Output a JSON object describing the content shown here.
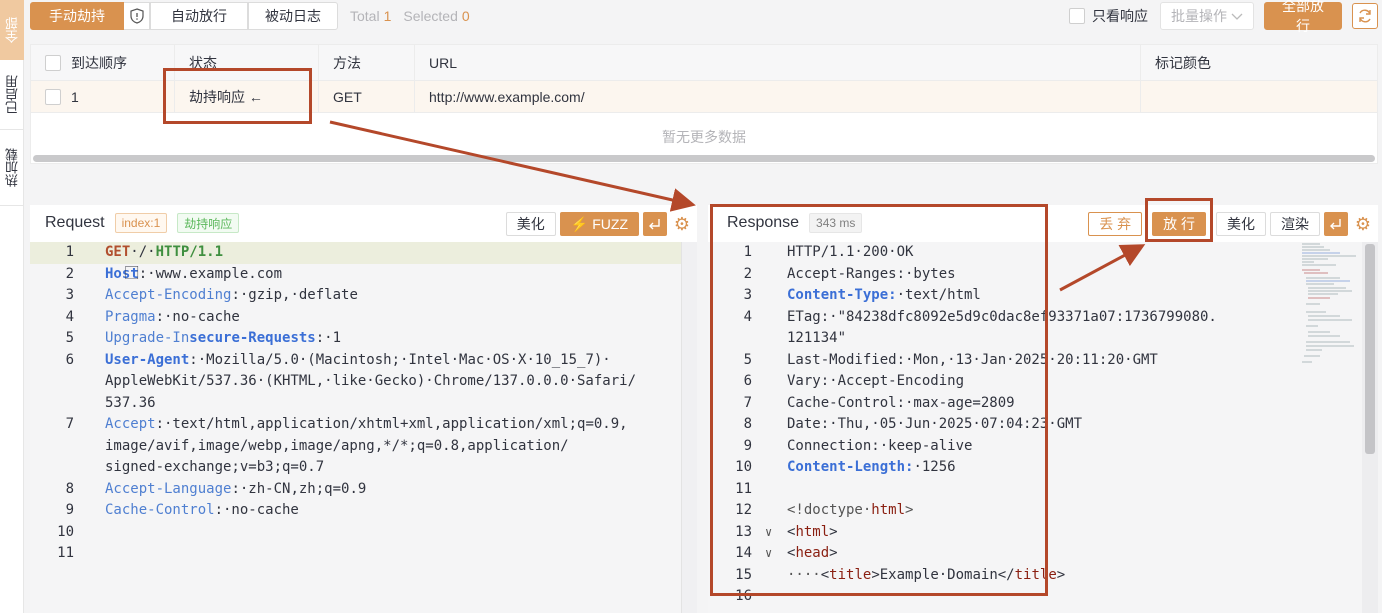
{
  "side_tabs": [
    "全部",
    "已启用",
    "热加载"
  ],
  "toolbar": {
    "hijack_label": "手动劫持",
    "auto_label": "自动放行",
    "log_label": "被动日志",
    "total_label": "Total",
    "total_value": "1",
    "selected_label": "Selected",
    "selected_value": "0",
    "only_response_label": "只看响应",
    "batch_label": "批量操作",
    "release_all_label": "全部放行"
  },
  "table": {
    "headers": [
      "到达顺序",
      "状态",
      "方法",
      "URL",
      "标记颜色"
    ],
    "rows": [
      {
        "order": "1",
        "status": "劫持响应 ←",
        "method": "GET",
        "url": "http://www.example.com/",
        "color": ""
      }
    ],
    "empty_text": "暂无更多数据"
  },
  "request": {
    "title": "Request",
    "index_tag": "index:1",
    "status_tag": "劫持响应",
    "beautify_label": "美化",
    "fuzz_label": "FUZZ"
  },
  "response": {
    "title": "Response",
    "time_tag": "343 ms",
    "drop_label": "丢 弃",
    "release_label": "放 行",
    "beautify_label": "美化",
    "render_label": "渲染"
  },
  "request_lines": [
    {
      "n": "1",
      "parts": [
        [
          "meth",
          "GET"
        ],
        [
          "",
          "·/·"
        ],
        [
          "proto",
          "HTTP/1.1"
        ]
      ]
    },
    {
      "n": "2",
      "parts": [
        [
          "keyb",
          "Host"
        ],
        [
          "",
          "⃞:·www.example.com"
        ]
      ]
    },
    {
      "n": "3",
      "parts": [
        [
          "key",
          "Accept-Encoding"
        ],
        [
          "",
          ":·gzip,·deflate"
        ]
      ]
    },
    {
      "n": "4",
      "parts": [
        [
          "key",
          "Pragma"
        ],
        [
          "",
          ":·no-cache"
        ]
      ]
    },
    {
      "n": "5",
      "parts": [
        [
          "key",
          "Upgrade-In"
        ],
        [
          "keyb",
          "secure-Requests"
        ],
        [
          "",
          ":·1"
        ]
      ]
    },
    {
      "n": "6",
      "parts": [
        [
          "keyb",
          "User-Agent"
        ],
        [
          "",
          ":·Mozilla/5.0·(Macintosh;·Intel·Mac·OS·X·10_15_7)·"
        ]
      ]
    },
    {
      "n": "",
      "parts": [
        [
          "",
          "AppleWebKit/537.36·(KHTML,·like·Gecko)·Chrome/137.0.0.0·Safari/"
        ]
      ]
    },
    {
      "n": "",
      "parts": [
        [
          "",
          "537.36"
        ]
      ]
    },
    {
      "n": "7",
      "parts": [
        [
          "key",
          "Accept"
        ],
        [
          "",
          ":·text/html,application/xhtml+xml,application/xml;q=0.9,"
        ]
      ]
    },
    {
      "n": "",
      "parts": [
        [
          "",
          "image/avif,image/webp,image/apng,*/*;q=0.8,application/"
        ]
      ]
    },
    {
      "n": "",
      "parts": [
        [
          "",
          "signed-exchange;v=b3;q=0.7"
        ]
      ]
    },
    {
      "n": "8",
      "parts": [
        [
          "key",
          "Accept-Language"
        ],
        [
          "",
          ":·zh-CN,zh;q=0.9"
        ]
      ]
    },
    {
      "n": "9",
      "parts": [
        [
          "key",
          "Cache-Control"
        ],
        [
          "",
          ":·no-cache"
        ]
      ]
    },
    {
      "n": "10",
      "parts": []
    },
    {
      "n": "11",
      "parts": []
    }
  ],
  "response_lines": [
    {
      "n": "1",
      "parts": [
        [
          "",
          "HTTP/1.1·200·OK"
        ]
      ]
    },
    {
      "n": "2",
      "parts": [
        [
          "",
          "Accept-Ranges:·bytes"
        ]
      ]
    },
    {
      "n": "3",
      "parts": [
        [
          "keyb",
          "Content-Type:"
        ],
        [
          "",
          "·text/html"
        ]
      ]
    },
    {
      "n": "4",
      "parts": [
        [
          "",
          "ETag:·\"84238dfc8092e5d9c0dac8ef93371a07:1736799080."
        ]
      ]
    },
    {
      "n": "",
      "parts": [
        [
          "",
          "121134\""
        ]
      ]
    },
    {
      "n": "5",
      "parts": [
        [
          "",
          "Last-Modified:·Mon,·13·Jan·2025·20:11:20·GMT"
        ]
      ]
    },
    {
      "n": "6",
      "parts": [
        [
          "",
          "Vary:·Accept-Encoding"
        ]
      ]
    },
    {
      "n": "7",
      "parts": [
        [
          "",
          "Cache-Control:·max-age=2809"
        ]
      ]
    },
    {
      "n": "8",
      "parts": [
        [
          "",
          "Date:·Thu,·05·Jun·2025·07:04:23·GMT"
        ]
      ]
    },
    {
      "n": "9",
      "parts": [
        [
          "",
          "Connection:·keep-alive"
        ]
      ]
    },
    {
      "n": "10",
      "parts": [
        [
          "keyb",
          "Content-Length:"
        ],
        [
          "",
          "·1256"
        ]
      ]
    },
    {
      "n": "11",
      "parts": []
    },
    {
      "n": "12",
      "parts": [
        [
          "attrc",
          "<!doctype·"
        ],
        [
          "tagc",
          "html"
        ],
        [
          "attrc",
          ">"
        ]
      ]
    },
    {
      "n": "13",
      "fold": true,
      "parts": [
        [
          "",
          "<"
        ],
        [
          "tagc",
          "html"
        ],
        [
          "",
          ">"
        ]
      ]
    },
    {
      "n": "14",
      "fold": true,
      "parts": [
        [
          "",
          "<"
        ],
        [
          "tagc",
          "head"
        ],
        [
          "",
          ">"
        ]
      ]
    },
    {
      "n": "15",
      "parts": [
        [
          "attrc",
          "····"
        ],
        [
          "",
          "<"
        ],
        [
          "tagc",
          "title"
        ],
        [
          "",
          ">Example·Domain</"
        ],
        [
          "tagc",
          "title"
        ],
        [
          "",
          ">"
        ]
      ]
    },
    {
      "n": "16",
      "parts": []
    }
  ]
}
